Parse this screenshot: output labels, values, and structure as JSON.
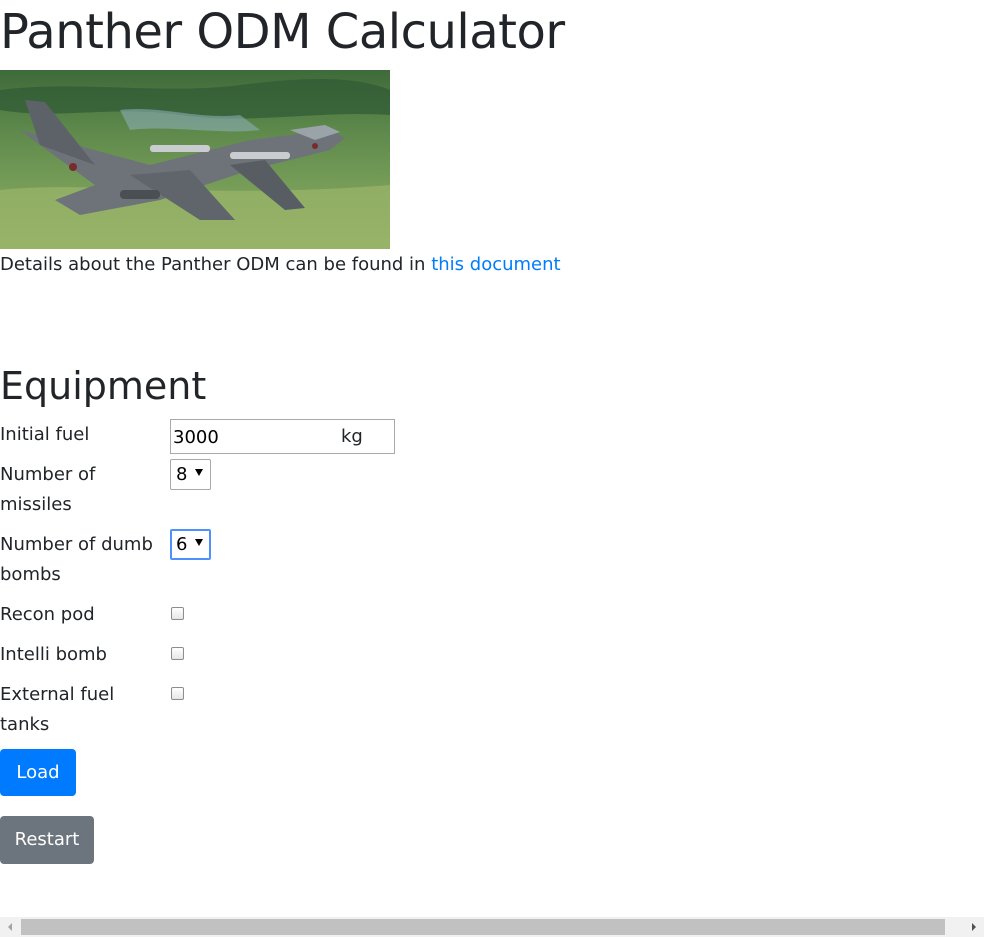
{
  "page": {
    "title": "Panther ODM Calculator"
  },
  "intro": {
    "details_text": "Details about the Panther ODM can be found in ",
    "link_text": "this document"
  },
  "equipment": {
    "heading": "Equipment",
    "initial_fuel": {
      "label": "Initial fuel",
      "value": "3000",
      "unit": "kg"
    },
    "missiles": {
      "label": "Number of missiles",
      "selected": "8"
    },
    "dumb_bombs": {
      "label": "Number of dumb bombs",
      "selected": "6"
    },
    "recon_pod": {
      "label": "Recon pod",
      "checked": false
    },
    "intelli_bomb": {
      "label": "Intelli bomb",
      "checked": false
    },
    "external_fuel_tanks": {
      "label": "External fuel tanks",
      "checked": false
    }
  },
  "actions": {
    "load_label": "Load",
    "restart_label": "Restart"
  },
  "colors": {
    "primary": "#007bff",
    "secondary": "#6c757d",
    "text": "#212529",
    "link": "#007bff"
  },
  "icons": {
    "select_arrow": "triangle-down",
    "scroll_left": "triangle-left",
    "scroll_right": "triangle-right"
  }
}
